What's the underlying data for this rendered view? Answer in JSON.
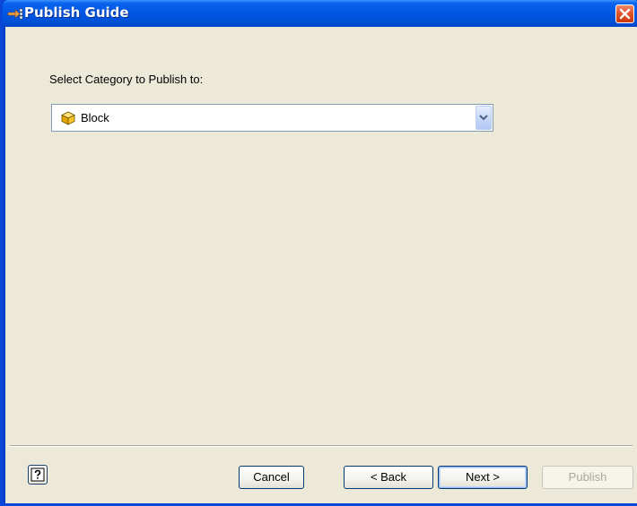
{
  "window": {
    "title": "Publish Guide"
  },
  "main": {
    "category_label": "Select Category to Publish to:",
    "category_select": {
      "selected_value": "Block",
      "icon": "block-cube-icon"
    }
  },
  "footer": {
    "help_icon": "help-icon",
    "cancel_label": "Cancel",
    "back_label": "< Back",
    "next_label": "Next >",
    "publish_label": "Publish"
  },
  "colors": {
    "titlebar": "#0058e6",
    "client_background": "#ece9d8",
    "close_button": "#e2552b",
    "disabled_text": "#aca899"
  }
}
